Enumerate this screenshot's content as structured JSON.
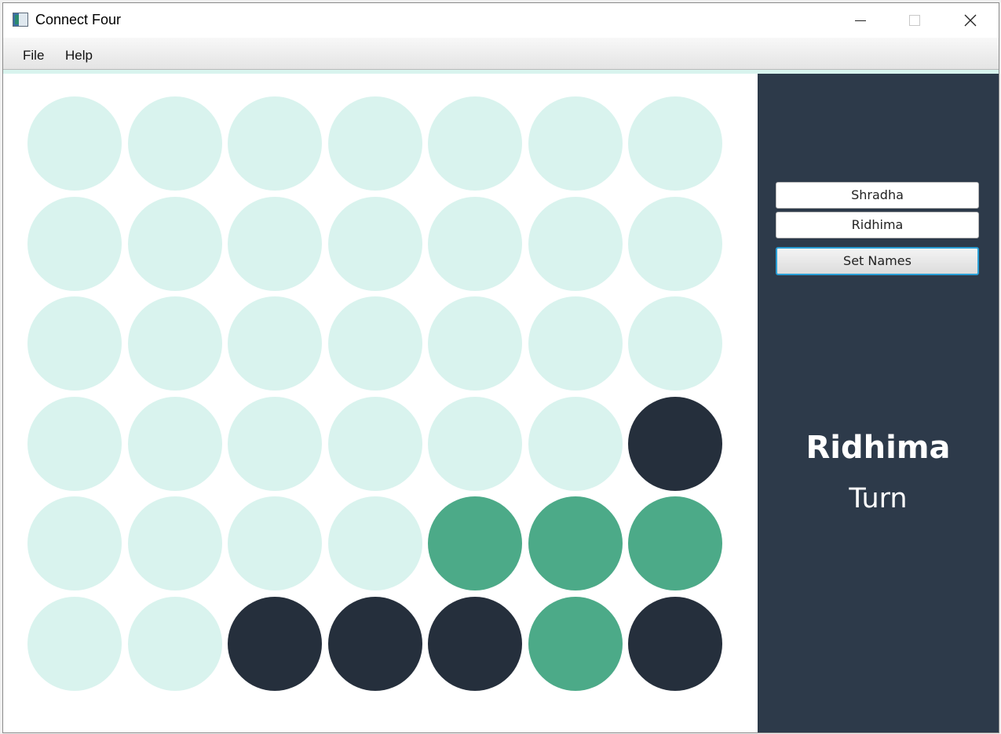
{
  "window": {
    "title": "Connect Four"
  },
  "menu": {
    "file": "File",
    "help": "Help"
  },
  "colors": {
    "empty": "#d9f3ee",
    "player1": "#4caa88",
    "player2": "#252f3c",
    "sidebar": "#2d3a4a"
  },
  "board": {
    "rows": 6,
    "columns": 7,
    "cells": [
      [
        "empty",
        "empty",
        "empty",
        "empty",
        "empty",
        "empty",
        "empty"
      ],
      [
        "empty",
        "empty",
        "empty",
        "empty",
        "empty",
        "empty",
        "empty"
      ],
      [
        "empty",
        "empty",
        "empty",
        "empty",
        "empty",
        "empty",
        "empty"
      ],
      [
        "empty",
        "empty",
        "empty",
        "empty",
        "empty",
        "empty",
        "player2"
      ],
      [
        "empty",
        "empty",
        "empty",
        "empty",
        "player1",
        "player1",
        "player1"
      ],
      [
        "empty",
        "empty",
        "player2",
        "player2",
        "player2",
        "player1",
        "player2"
      ]
    ]
  },
  "sidebar": {
    "player_one_name": "Shradha",
    "player_two_name": "Ridhima",
    "set_names_label": "Set Names",
    "current_player": "Ridhima",
    "turn_label": "Turn"
  }
}
